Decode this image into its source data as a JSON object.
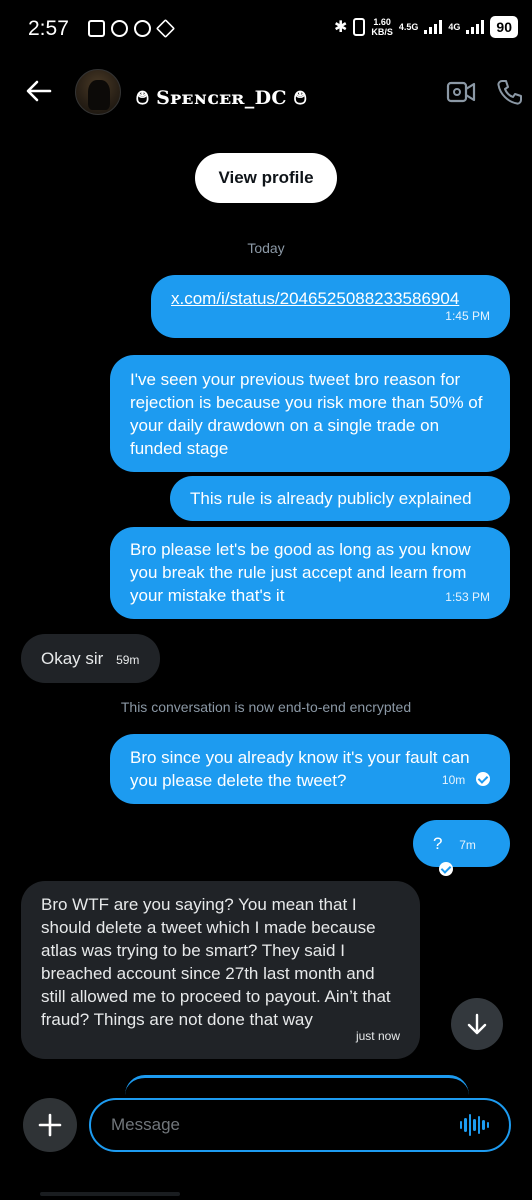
{
  "status_bar": {
    "time": "2:57",
    "speed": "1.60",
    "speed_unit": "KB/S",
    "net1": "4.5G",
    "net2": "4G",
    "battery": "90"
  },
  "header": {
    "contact_name": "࿉ Sᴘᴇɴᴄᴇʀ_DC ࿉",
    "back_icon": "arrow-left-icon",
    "video_icon": "video-call-icon",
    "phone_icon": "phone-icon"
  },
  "view_profile_label": "View profile",
  "day_separator": "Today",
  "messages": [
    {
      "dir": "out",
      "link": "x.com/i/status/2046525088233586904",
      "time": "1:45 PM"
    },
    {
      "dir": "out",
      "text": "I've seen your previous tweet bro reason for rejection is because you risk more than 50% of your daily drawdown on a single trade on funded stage"
    },
    {
      "dir": "out",
      "text": "This rule is already publicly explained"
    },
    {
      "dir": "out",
      "text": "Bro please let's be good as long as you know you break the rule just accept and learn from your mistake that's it",
      "time": "1:53 PM"
    },
    {
      "dir": "in",
      "text": "Okay sir",
      "time": "59m"
    },
    {
      "dir": "out",
      "text": "Bro since you already know it's your fault can you please delete the tweet?",
      "time": "10m"
    },
    {
      "dir": "out",
      "text": "?",
      "time": "7m"
    },
    {
      "dir": "in",
      "text": "Bro WTF are you saying? You mean that I should delete a tweet which I made because atlas was trying to be smart? They said I breached account since 27th last month and still allowed me to proceed to payout. Ain’t that fraud? Things are not done that way",
      "time": "just now"
    }
  ],
  "system_notice": "This conversation is now end-to-end encrypted",
  "composer": {
    "placeholder": "Message",
    "plus_icon": "plus-icon",
    "voice_icon": "voice-waveform-icon"
  },
  "colors": {
    "accent": "#1d9bf0",
    "incoming_bubble": "#202327",
    "background": "#000000"
  }
}
